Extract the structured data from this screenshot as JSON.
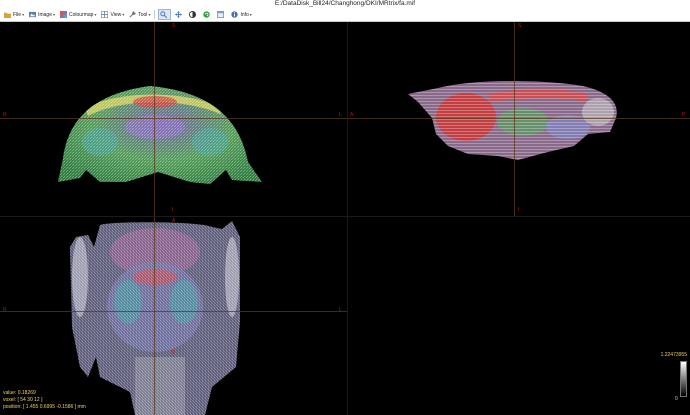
{
  "window": {
    "title": "E:/DataDisk_Bill24/Changhong/DKI/MRtrix/fa.mif"
  },
  "toolbar": {
    "items": [
      {
        "label": "File",
        "icon": "folder-icon",
        "color": "#d6a437",
        "has_menu": true
      },
      {
        "label": "Image",
        "icon": "image-icon",
        "color": "#5d7fa8",
        "has_menu": true
      },
      {
        "label": "Colourmap",
        "icon": "colourmap-icon",
        "color": "#8a6fb0",
        "has_menu": true
      },
      {
        "label": "View",
        "icon": "view-icon",
        "color": "#6a8bb8",
        "has_menu": true
      },
      {
        "label": "Tool",
        "icon": "tool-icon",
        "color": "#7a7a7a",
        "has_menu": true
      },
      {
        "label": "",
        "icon": "zoom-icon",
        "color": "#5a82c4",
        "has_menu": false,
        "pressed": true
      },
      {
        "label": "",
        "icon": "move-icon",
        "color": "#3a6fc0",
        "has_menu": false
      },
      {
        "label": "",
        "icon": "contrast-icon",
        "color": "#333333",
        "has_menu": false
      },
      {
        "label": "",
        "icon": "rotate-icon",
        "color": "#2e9a3c",
        "has_menu": false
      },
      {
        "label": "",
        "icon": "window-icon",
        "color": "#7e9cc0",
        "has_menu": false
      },
      {
        "label": "Info",
        "icon": "info-icon",
        "color": "#3f6fb5",
        "has_menu": true
      }
    ]
  },
  "views": {
    "coronal": {
      "top": "S",
      "bottom": "I",
      "left": "R",
      "right": "L"
    },
    "sagittal": {
      "top": "S",
      "bottom": "I",
      "left": "A",
      "right": "P"
    },
    "axial": {
      "top": "A",
      "bottom": "P",
      "left": "R",
      "right": "L"
    }
  },
  "info": {
    "value": "value: 0.18269",
    "voxel": "voxel: [ 54 30 12 ]",
    "position": "position: [ 1.455 0.6995 -0.1586 ] mm"
  },
  "colorbar": {
    "max": "1.22473955",
    "min": "0"
  },
  "colors": {
    "orientation_label": "#c21414",
    "info_text": "#f0d060",
    "crosshair": "#5a3a1a"
  }
}
